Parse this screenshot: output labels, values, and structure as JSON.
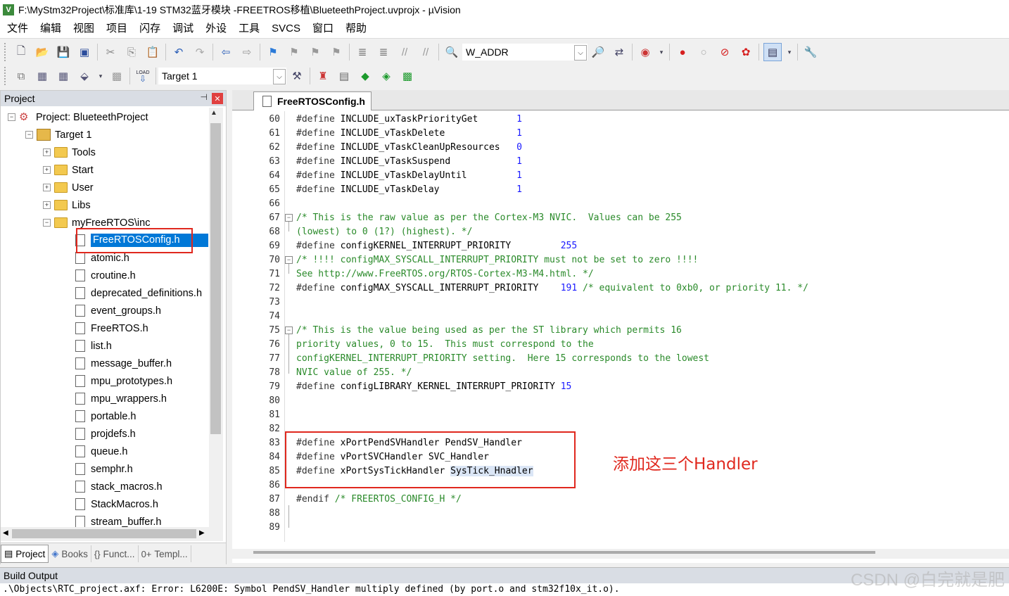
{
  "window": {
    "title": "F:\\MyStm32Project\\标准库\\1-19 STM32蓝牙模块 -FREETROS移植\\BlueteethProject.uvprojx - µVision",
    "icon": "V"
  },
  "menu": [
    "文件",
    "编辑",
    "视图",
    "项目",
    "闪存",
    "调试",
    "外设",
    "工具",
    "SVCS",
    "窗口",
    "帮助"
  ],
  "toolbar1": {
    "combo_value": "W_ADDR"
  },
  "toolbar2": {
    "target_value": "Target 1",
    "load_label": "LOAD"
  },
  "project_panel": {
    "title": "Project",
    "pin": "⊣",
    "close": "✕",
    "project_root": "Project: BlueteethProject",
    "target": "Target 1",
    "groups": [
      "Tools",
      "Start",
      "User",
      "Libs",
      "myFreeRTOS\\inc"
    ],
    "files": [
      "FreeRTOSConfig.h",
      "atomic.h",
      "croutine.h",
      "deprecated_definitions.h",
      "event_groups.h",
      "FreeRTOS.h",
      "list.h",
      "message_buffer.h",
      "mpu_prototypes.h",
      "mpu_wrappers.h",
      "portable.h",
      "projdefs.h",
      "queue.h",
      "semphr.h",
      "stack_macros.h",
      "StackMacros.h",
      "stream_buffer.h"
    ],
    "selected_file": "FreeRTOSConfig.h",
    "tabs": [
      {
        "label": "Project",
        "icon": "▤"
      },
      {
        "label": "Books",
        "icon": "◈"
      },
      {
        "label": "Funct...",
        "icon": "{}"
      },
      {
        "label": "Templ...",
        "icon": "0+"
      }
    ]
  },
  "editor": {
    "active_tab": "FreeRTOSConfig.h",
    "line_numbers": [
      "60",
      "61",
      "62",
      "63",
      "64",
      "65",
      "66",
      "67",
      "68",
      "69",
      "70",
      "71",
      "72",
      "73",
      "74",
      "75",
      "76",
      "77",
      "78",
      "79",
      "80",
      "81",
      "82",
      "83",
      "84",
      "85",
      "86",
      "87",
      "88",
      "89"
    ],
    "lines": [
      {
        "kw": "#define ",
        "name": "INCLUDE_uxTaskPriorityGet       ",
        "val": "1"
      },
      {
        "kw": "#define ",
        "name": "INCLUDE_vTaskDelete             ",
        "val": "1"
      },
      {
        "kw": "#define ",
        "name": "INCLUDE_vTaskCleanUpResources   ",
        "val": "0"
      },
      {
        "kw": "#define ",
        "name": "INCLUDE_vTaskSuspend            ",
        "val": "1"
      },
      {
        "kw": "#define ",
        "name": "INCLUDE_vTaskDelayUntil         ",
        "val": "1"
      },
      {
        "kw": "#define ",
        "name": "INCLUDE_vTaskDelay              ",
        "val": "1"
      },
      {
        "kw": "",
        "name": "",
        "val": ""
      },
      {
        "cm": "/* This is the raw value as per the Cortex-M3 NVIC.  Values can be 255"
      },
      {
        "cm": "(lowest) to 0 (1?) (highest). */"
      },
      {
        "kw": "#define ",
        "name": "configKERNEL_INTERRUPT_PRIORITY         ",
        "val": "255"
      },
      {
        "cm": "/* !!!! configMAX_SYSCALL_INTERRUPT_PRIORITY must not be set to zero !!!!"
      },
      {
        "cm": "See http://www.FreeRTOS.org/RTOS-Cortex-M3-M4.html. */"
      },
      {
        "kw": "#define ",
        "name": "configMAX_SYSCALL_INTERRUPT_PRIORITY    ",
        "val": "191",
        "tail": " /* equivalent to 0xb0, or priority 11. */"
      },
      {
        "kw": "",
        "name": "",
        "val": ""
      },
      {
        "kw": "",
        "name": "",
        "val": ""
      },
      {
        "cm": "/* This is the value being used as per the ST library which permits 16"
      },
      {
        "cm": "priority values, 0 to 15.  This must correspond to the"
      },
      {
        "cm": "configKERNEL_INTERRUPT_PRIORITY setting.  Here 15 corresponds to the lowest"
      },
      {
        "cm": "NVIC value of 255. */"
      },
      {
        "kw": "#define ",
        "name": "configLIBRARY_KERNEL_INTERRUPT_PRIORITY ",
        "val": "15"
      },
      {
        "kw": "",
        "name": "",
        "val": ""
      },
      {
        "kw": "",
        "name": "",
        "val": ""
      },
      {
        "kw": "",
        "name": "",
        "val": ""
      },
      {
        "kw": "#define ",
        "name": "xPortPendSVHandler PendSV_Handler",
        "val": ""
      },
      {
        "kw": "#define ",
        "name": "vPortSVCHandler SVC_Handler",
        "val": ""
      },
      {
        "kw": "#define ",
        "name": "xPortSysTickHandler ",
        "hl": "SysTick_Hnadler",
        "val": ""
      },
      {
        "kw": "",
        "name": "",
        "val": ""
      },
      {
        "kw": "#endif ",
        "cm2": "/* FREERTOS_CONFIG_H */",
        "name": "",
        "val": ""
      },
      {
        "kw": "",
        "name": "",
        "val": ""
      },
      {
        "kw": "",
        "name": "",
        "val": ""
      }
    ],
    "annotation": "添加这三个Handler"
  },
  "build_output": {
    "title": "Build Output",
    "line": ".\\Objects\\RTC_project.axf: Error: L6200E: Symbol PendSV_Handler multiply defined (by port.o and stm32f10x_it.o)."
  },
  "watermark": "CSDN @白完就是肥",
  "colors": {
    "selection": "#0078d7",
    "annotation_red": "#e0281e",
    "comment_green": "#2a8a2a",
    "number_blue": "#1a1aff"
  }
}
